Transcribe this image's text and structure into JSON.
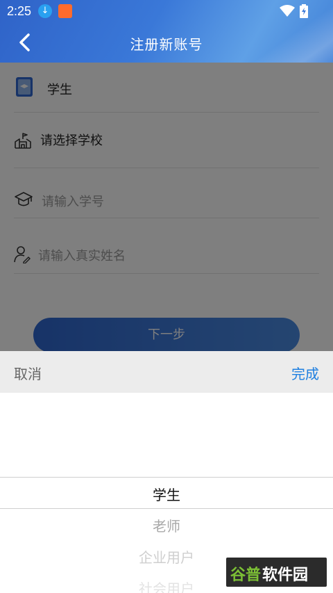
{
  "status": {
    "time": "2:25"
  },
  "header": {
    "title": "注册新账号"
  },
  "form": {
    "role_value": "学生",
    "school_label": "请选择学校",
    "student_id_placeholder": "请输入学号",
    "name_placeholder": "请输入真实姓名",
    "next_label": "下一步"
  },
  "picker": {
    "cancel_label": "取消",
    "done_label": "完成",
    "options": [
      "学生",
      "老师",
      "企业用户",
      "社会用户"
    ],
    "selected_index": 0
  },
  "watermark": {
    "part_a": "谷普",
    "part_b": "软件园"
  },
  "colors": {
    "accent": "#1e7fe0",
    "header": "#3a78d8",
    "button": "#2f67d0"
  }
}
